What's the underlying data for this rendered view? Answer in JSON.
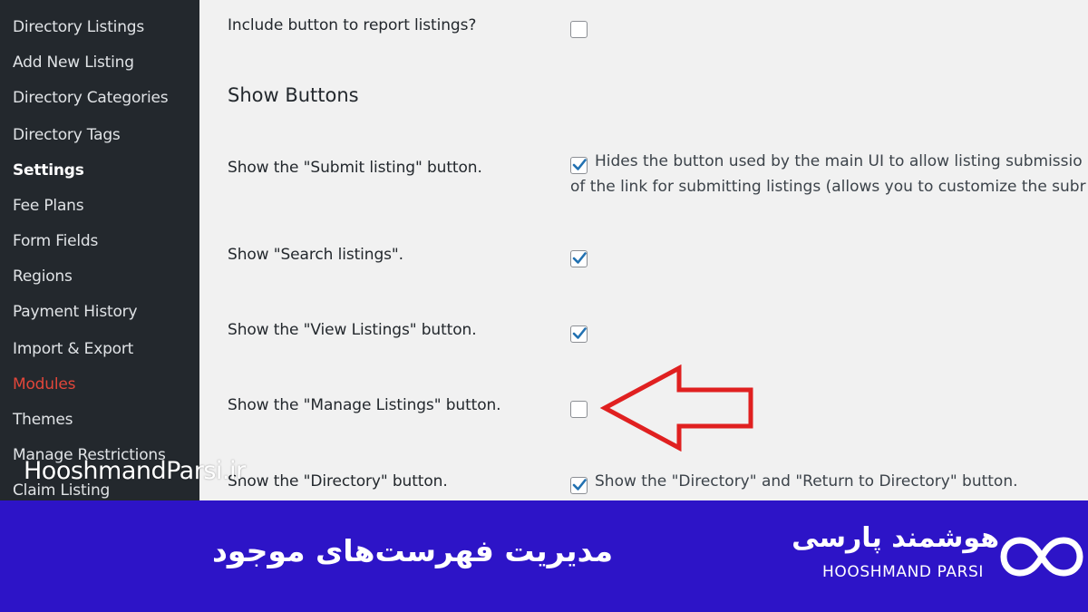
{
  "sidebar": {
    "items": [
      {
        "label": "Directory Listings"
      },
      {
        "label": "Add New Listing"
      },
      {
        "label": "Directory Categories"
      },
      {
        "label": "Directory Tags"
      },
      {
        "label": "Settings"
      },
      {
        "label": "Fee Plans"
      },
      {
        "label": "Form Fields"
      },
      {
        "label": "Regions"
      },
      {
        "label": "Payment History"
      },
      {
        "label": "Import & Export"
      },
      {
        "label": "Modules"
      },
      {
        "label": "Themes"
      },
      {
        "label": "Manage Restrictions"
      },
      {
        "label": "Claim Listing"
      }
    ]
  },
  "watermark": "HooshmandParsi.ir",
  "settings": {
    "report": {
      "label": "Include button to report listings?",
      "checked": false
    },
    "section_heading": "Show Buttons",
    "submit": {
      "label": "Show the \"Submit listing\" button.",
      "checked": true,
      "description_line1": "Hides the button used by the main UI to allow listing submissio",
      "description_line2": "of the link for submitting listings (allows you to customize the subr"
    },
    "search": {
      "label": "Show \"Search listings\".",
      "checked": true
    },
    "view": {
      "label": "Show the \"View Listings\" button.",
      "checked": true
    },
    "manage": {
      "label": "Show the \"Manage Listings\" button.",
      "checked": false
    },
    "directory": {
      "label": "Show the \"Directory\" button.",
      "checked": true,
      "description": "Show the \"Directory\" and \"Return to Directory\" button."
    }
  },
  "annotation": {
    "icon": "red-arrow-icon",
    "color": "#e02020"
  },
  "banner": {
    "title": "مدیریت فهرست‌های موجود",
    "brand_fa": "هوشمند پارسی",
    "brand_en": "HOOSHMAND PARSI",
    "logo_icon": "infinity-icon",
    "background": "#2d14c7"
  },
  "colors": {
    "sidebar_bg": "#23282d",
    "accent_active": "#e2463a",
    "checkmark": "#2271b1"
  }
}
